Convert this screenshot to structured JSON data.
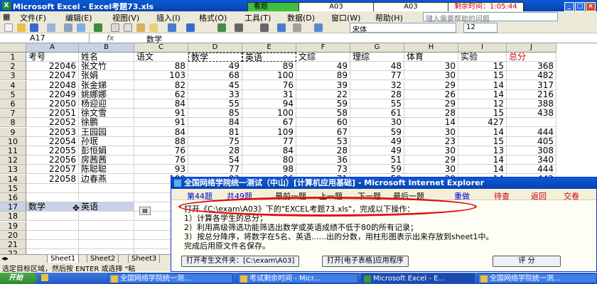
{
  "window": {
    "title": "Microsoft Excel - Excel考题73.xls",
    "controls": [
      "_",
      "□",
      "×"
    ]
  },
  "exam_status": {
    "mode": "看题",
    "id1": "A03",
    "id2": "A03",
    "remaining_label": "剩余时间：",
    "remaining_time": "1:05:44"
  },
  "menu": {
    "items": [
      "文件(F)",
      "编辑(E)",
      "视图(V)",
      "插入(I)",
      "格式(O)",
      "工具(T)",
      "数据(D)",
      "窗口(W)",
      "帮助(H)"
    ],
    "help_placeholder": "键入需要帮助的问题"
  },
  "toolbar": {
    "font": "宋体",
    "size": "12"
  },
  "formula_bar": {
    "name_box": "A17",
    "fx": "fx",
    "content": "数学"
  },
  "columns": [
    "A",
    "B",
    "C",
    "D",
    "E",
    "F",
    "G",
    "H",
    "I",
    "J"
  ],
  "header_row": [
    "考号",
    "姓名",
    "语文",
    "数学",
    "英语",
    "文综",
    "理综",
    "体育",
    "实验",
    "总分"
  ],
  "rows": [
    [
      "22046",
      "张文竹",
      "88",
      "49",
      "89",
      "49",
      "48",
      "30",
      "15",
      "368"
    ],
    [
      "22047",
      "张娟",
      "103",
      "68",
      "100",
      "89",
      "77",
      "30",
      "15",
      "482"
    ],
    [
      "22048",
      "张金娣",
      "82",
      "45",
      "76",
      "39",
      "32",
      "29",
      "14",
      "317"
    ],
    [
      "22049",
      "姚娜娜",
      "62",
      "33",
      "31",
      "22",
      "28",
      "26",
      "14",
      "216"
    ],
    [
      "22050",
      "杨迎迎",
      "84",
      "55",
      "94",
      "59",
      "55",
      "29",
      "12",
      "388"
    ],
    [
      "22051",
      "徐文雪",
      "91",
      "85",
      "100",
      "58",
      "61",
      "28",
      "15",
      "438"
    ],
    [
      "22052",
      "徐鹏",
      "91",
      "84",
      "67",
      "60",
      "30",
      "14",
      "427"
    ],
    [
      "22053",
      "王园园",
      "84",
      "81",
      "109",
      "67",
      "59",
      "30",
      "14",
      "444"
    ],
    [
      "22054",
      "孙珉",
      "88",
      "75",
      "77",
      "53",
      "49",
      "23",
      "15",
      "405"
    ],
    [
      "22055",
      "彭恒娟",
      "76",
      "28",
      "84",
      "28",
      "49",
      "30",
      "13",
      "308"
    ],
    [
      "22056",
      "房茜茜",
      "76",
      "54",
      "80",
      "36",
      "51",
      "29",
      "14",
      "340"
    ],
    [
      "22057",
      "陈聪聪",
      "93",
      "77",
      "98",
      "73",
      "59",
      "30",
      "14",
      "444"
    ],
    [
      "22058",
      "边春燕",
      "100",
      "83",
      "86",
      "71",
      "59",
      "29",
      "14",
      "442"
    ]
  ],
  "row17": {
    "a": "数学",
    "b": "英语"
  },
  "row_numbers": [
    "1",
    "2",
    "3",
    "4",
    "5",
    "6",
    "7",
    "8",
    "9",
    "10",
    "11",
    "12",
    "13",
    "14",
    "15",
    "16",
    "17",
    "18",
    "19",
    "20",
    "21",
    "22",
    "23",
    "24",
    "25",
    "26"
  ],
  "sheet_tabs": [
    "Sheet1",
    "Sheet2",
    "Sheet3"
  ],
  "status_text": "选定目标区域，然后按 ENTER 或选择 \"粘",
  "taskbar": {
    "start": "开始",
    "tasks": [
      "全国网络学院统一测...",
      "考试剩余时间 - Micr...",
      "Microsoft Excel - E...",
      "全国网络学院统一测..."
    ]
  },
  "ie": {
    "title": "全国网络学院统一测试（中山）[计算机应用基础] - Microsoft Internet Explorer",
    "q_current": "第44题",
    "q_total": "共49题",
    "nav": [
      "最前一题",
      "上一题",
      "下一题",
      "最后一题"
    ],
    "redo": "重做",
    "pending": "待查",
    "back": "返回",
    "submit": "交卷",
    "line1": "打开《C:\\exam\\A03》下的\"EXCEL考题73.xls\"，完成以下操作：",
    "line2": "1）计算各学生的总分；",
    "line3": "2）利用高级筛选功能筛选出数学或英语成绩不低于80的所有记录；",
    "line4": "3）按总分降序，将数字在5名、英语......出的分数，用柱形图表示出来存放到sheet1中。",
    "line5": "完成后用原文件名保存。",
    "btn_folder": "打开考生文件夹：[C:\\exam\\A03]",
    "btn_open": "打开[电子表格]应用程序",
    "btn_grade": "评  分"
  }
}
